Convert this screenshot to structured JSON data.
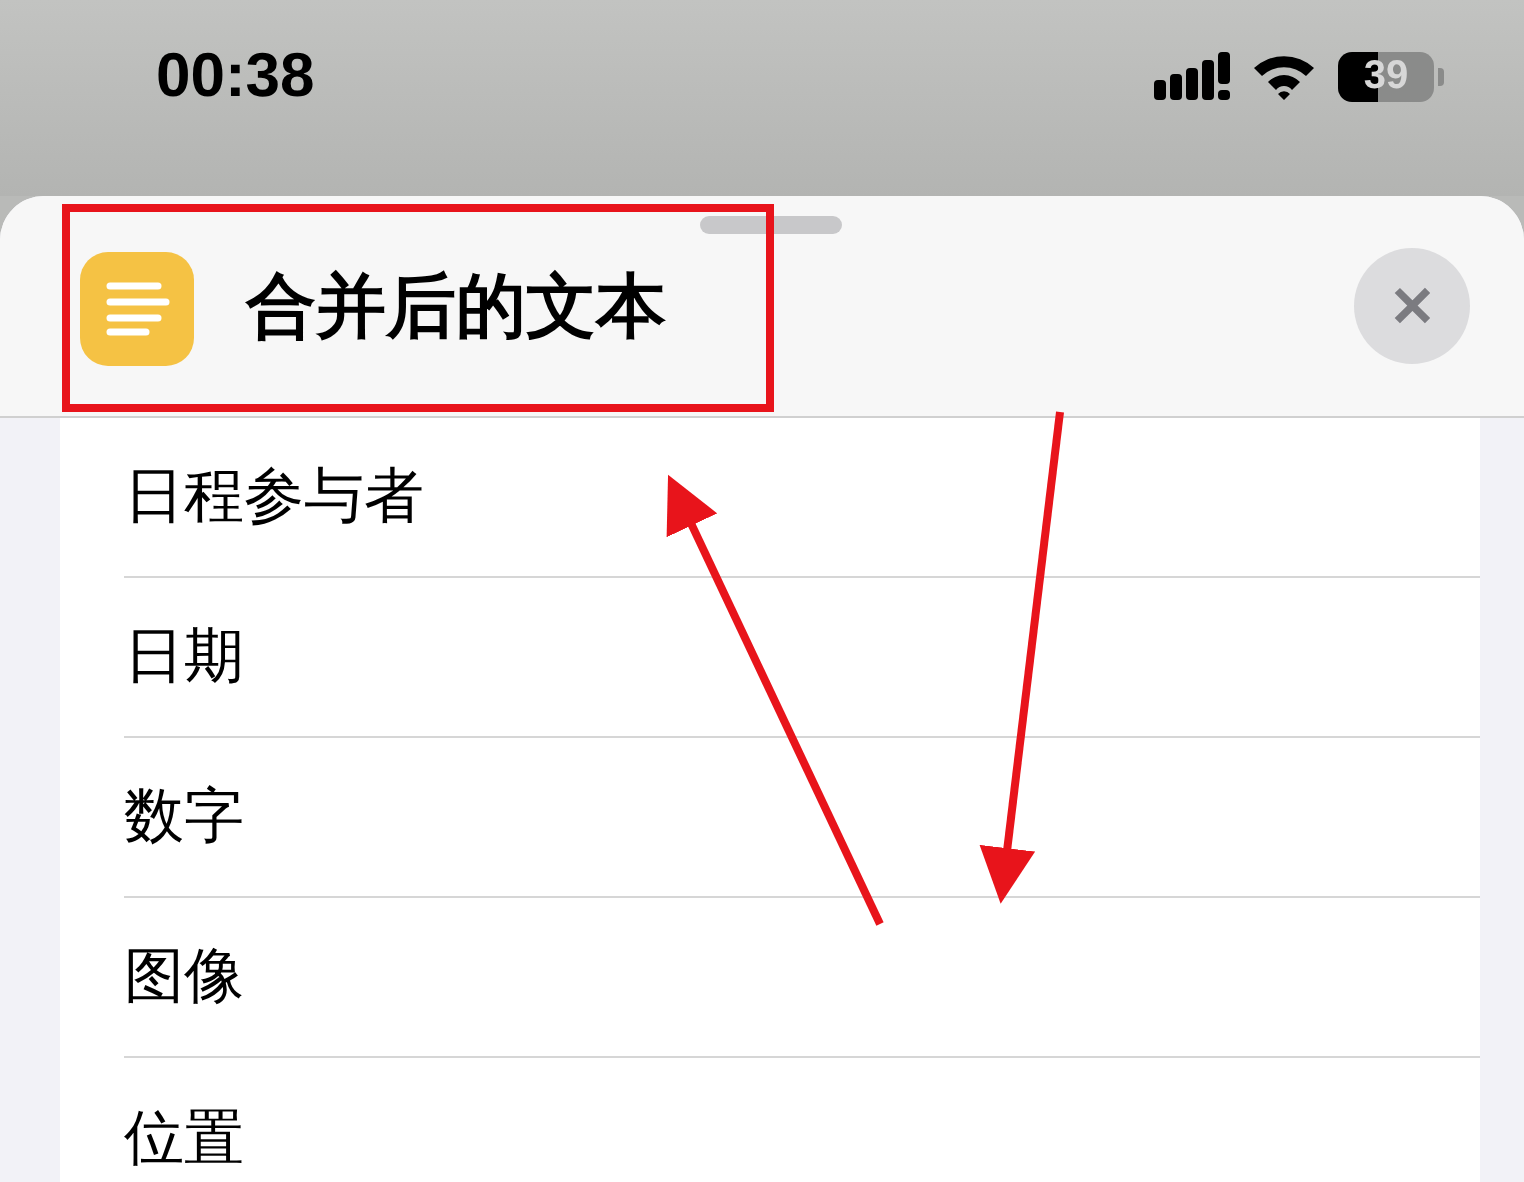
{
  "status_bar": {
    "time": "00:38",
    "battery": "39"
  },
  "sheet": {
    "title": "合并后的文本",
    "close": "✕"
  },
  "items": [
    {
      "label": "日程参与者"
    },
    {
      "label": "日期"
    },
    {
      "label": "数字"
    },
    {
      "label": "图像"
    },
    {
      "label": "位置"
    }
  ]
}
